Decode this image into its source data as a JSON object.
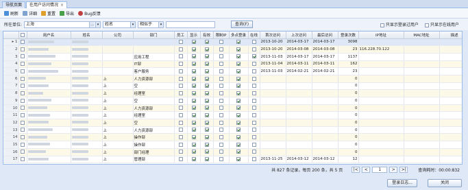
{
  "tabs": [
    {
      "label": "导航页面"
    },
    {
      "label": "在用户访问情况",
      "close": "×"
    }
  ],
  "toolbar": {
    "refresh": "刷新",
    "detail": "详细",
    "reset": "重置",
    "export": "导出",
    "bug": "Bug反馈"
  },
  "filter": {
    "unit_label": "所在单位:",
    "unit_value": "上海",
    "unit_dots": "...",
    "field_value": "姓名",
    "op_value": "相似于",
    "query_label": "查询(F)",
    "only_logged_label": "只显示登录过用户",
    "only_online_label": "只显示在线用户"
  },
  "columns": [
    "",
    "",
    "用户名",
    "姓名",
    "公司",
    "部门",
    "员工",
    "显示",
    "有效",
    "限制IP",
    "多点登录",
    "在线",
    "首次访问",
    "上次访问",
    "最后访问",
    "登录次数",
    "IP地址",
    "MAC地址",
    "描述"
  ],
  "rows": [
    {
      "n": "1",
      "co": "",
      "dept": "",
      "s": [
        0,
        1,
        1,
        0,
        1,
        0
      ],
      "first": "2013-10-20",
      "last": "2014-03-17",
      "latest": "2014-03-17",
      "count": "3098",
      "ip": ""
    },
    {
      "n": "2",
      "co": "",
      "dept": "",
      "s": [
        0,
        1,
        1,
        0,
        1,
        0
      ],
      "first": "2013-10-20",
      "last": "2014-03-08",
      "latest": "2014-03-08",
      "count": "23",
      "ip": "116.228.70.122"
    },
    {
      "n": "3",
      "co": "",
      "dept": "应用工程",
      "s": [
        0,
        1,
        1,
        0,
        1,
        1
      ],
      "first": "2013-11-03",
      "last": "2014-03-17",
      "latest": "2014-03-17",
      "count": "1137",
      "ip": ""
    },
    {
      "n": "4",
      "co": "",
      "dept": "IT部",
      "s": [
        0,
        1,
        1,
        0,
        1,
        0
      ],
      "first": "2013-11-04",
      "last": "2014-03-11",
      "latest": "2014-03-11",
      "count": "162",
      "ip": ""
    },
    {
      "n": "5",
      "co": "",
      "dept": "客户服务",
      "s": [
        0,
        1,
        1,
        0,
        1,
        0
      ],
      "first": "2013-11-03",
      "last": "2014-02-21",
      "latest": "2014-02-21",
      "count": "23",
      "ip": ""
    },
    {
      "n": "6",
      "co": "上",
      "dept": "人力资源部",
      "s": [
        0,
        1,
        1,
        0,
        1,
        0
      ],
      "first": "",
      "last": "",
      "latest": "",
      "count": "0",
      "ip": ""
    },
    {
      "n": "7",
      "co": "上",
      "dept": "空",
      "s": [
        0,
        1,
        1,
        0,
        1,
        0
      ],
      "first": "",
      "last": "",
      "latest": "",
      "count": "0",
      "ip": ""
    },
    {
      "n": "8",
      "co": "上",
      "dept": "经理室",
      "s": [
        0,
        1,
        1,
        0,
        1,
        0
      ],
      "first": "",
      "last": "",
      "latest": "",
      "count": "0",
      "ip": ""
    },
    {
      "n": "9",
      "co": "上",
      "dept": "空",
      "s": [
        0,
        1,
        1,
        0,
        1,
        0
      ],
      "first": "",
      "last": "",
      "latest": "",
      "count": "0",
      "ip": ""
    },
    {
      "n": "10",
      "co": "上",
      "dept": "人力资源部",
      "s": [
        0,
        1,
        1,
        0,
        1,
        0
      ],
      "first": "",
      "last": "",
      "latest": "",
      "count": "0",
      "ip": ""
    },
    {
      "n": "11",
      "co": "上",
      "dept": "经理室",
      "s": [
        0,
        1,
        1,
        0,
        1,
        0
      ],
      "first": "",
      "last": "",
      "latest": "",
      "count": "0",
      "ip": ""
    },
    {
      "n": "12",
      "co": "上",
      "dept": "空",
      "s": [
        0,
        1,
        1,
        0,
        1,
        0
      ],
      "first": "",
      "last": "",
      "latest": "",
      "count": "0",
      "ip": ""
    },
    {
      "n": "13",
      "co": "上",
      "dept": "人力资源部",
      "s": [
        0,
        1,
        1,
        0,
        1,
        0
      ],
      "first": "",
      "last": "",
      "latest": "",
      "count": "0",
      "ip": ""
    },
    {
      "n": "14",
      "co": "上",
      "dept": "操作部",
      "s": [
        0,
        1,
        1,
        0,
        1,
        0
      ],
      "first": "",
      "last": "",
      "latest": "",
      "count": "0",
      "ip": ""
    },
    {
      "n": "15",
      "co": "上",
      "dept": "操作部",
      "s": [
        0,
        1,
        1,
        0,
        1,
        0
      ],
      "first": "",
      "last": "",
      "latest": "",
      "count": "0",
      "ip": ""
    },
    {
      "n": "16",
      "co": "上",
      "dept": "部门经理",
      "s": [
        0,
        1,
        1,
        0,
        1,
        0
      ],
      "first": "",
      "last": "",
      "latest": "",
      "count": "0",
      "ip": ""
    },
    {
      "n": "17",
      "co": "上",
      "dept": "管理部",
      "s": [
        0,
        1,
        1,
        0,
        1,
        0
      ],
      "first": "2013-11-25",
      "last": "2014-03-12",
      "latest": "2014-03-12",
      "count": "12",
      "ip": ""
    }
  ],
  "pager": {
    "summary": "共 827 条记录，每页 200 条，共 5 页",
    "first": "|<",
    "prev": "<",
    "page": "1",
    "next": ">",
    "last": ">|",
    "timer": "查询耗时：00:00:832"
  },
  "footer": {
    "login_log": "登录日志...",
    "close": "关闭"
  }
}
